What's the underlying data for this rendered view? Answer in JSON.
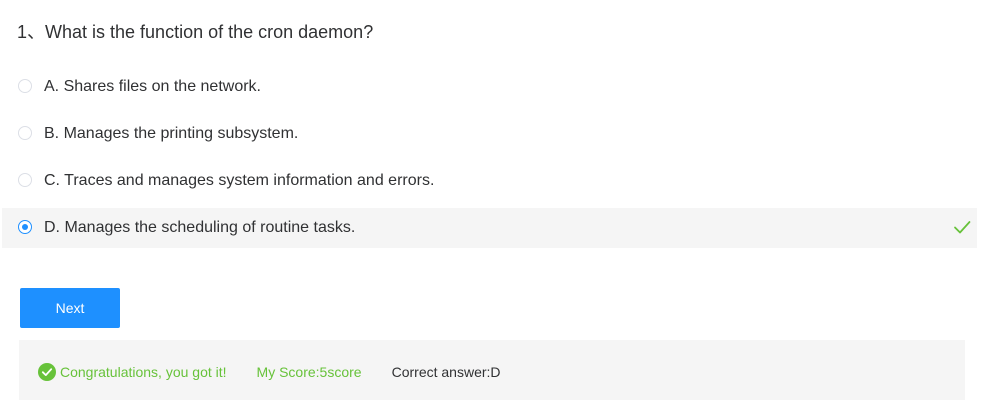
{
  "question": {
    "title": "1、What is the function of the cron daemon?"
  },
  "options": [
    {
      "label": "A. Shares files on the network.",
      "selected": false
    },
    {
      "label": "B. Manages the printing subsystem.",
      "selected": false
    },
    {
      "label": "C. Traces and manages system information and errors.",
      "selected": false
    },
    {
      "label": "D. Manages the scheduling of routine tasks.",
      "selected": true
    }
  ],
  "actions": {
    "next_label": "Next"
  },
  "result": {
    "congrats": "Congratulations, you got it!",
    "score": "My Score:5score",
    "correct_answer": "Correct answer:D"
  },
  "colors": {
    "accent": "#1e90ff",
    "success": "#67c23a",
    "selected_bg": "#f5f5f5",
    "text": "#303133"
  },
  "icons": {
    "selected_option_mark": "checkmark-icon",
    "result_mark": "check-circle-icon"
  }
}
